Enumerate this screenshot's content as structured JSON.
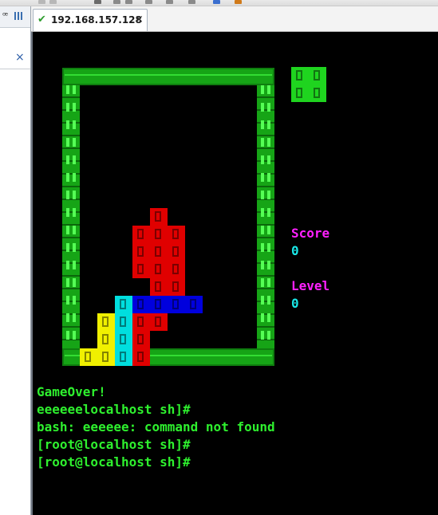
{
  "tab": {
    "title": "192.168.157.128",
    "status_icon": "check-icon",
    "close": "×"
  },
  "left_panel": {
    "pin_icon": "pin-icon",
    "close": "×"
  },
  "game": {
    "next_piece_color": "#1fd41f",
    "board_cells": [
      {
        "col": 4,
        "row": 7,
        "color": "#e00000"
      },
      {
        "col": 3,
        "row": 8,
        "color": "#e00000"
      },
      {
        "col": 4,
        "row": 8,
        "color": "#e00000"
      },
      {
        "col": 5,
        "row": 8,
        "color": "#e00000"
      },
      {
        "col": 3,
        "row": 9,
        "color": "#e00000"
      },
      {
        "col": 4,
        "row": 9,
        "color": "#e00000"
      },
      {
        "col": 5,
        "row": 9,
        "color": "#e00000"
      },
      {
        "col": 3,
        "row": 10,
        "color": "#e00000"
      },
      {
        "col": 4,
        "row": 10,
        "color": "#e00000"
      },
      {
        "col": 5,
        "row": 10,
        "color": "#e00000"
      },
      {
        "col": 4,
        "row": 11,
        "color": "#e00000"
      },
      {
        "col": 5,
        "row": 11,
        "color": "#e00000"
      },
      {
        "col": 2,
        "row": 12,
        "color": "#00dede"
      },
      {
        "col": 3,
        "row": 12,
        "color": "#0000dd"
      },
      {
        "col": 4,
        "row": 12,
        "color": "#0000dd"
      },
      {
        "col": 5,
        "row": 12,
        "color": "#0000dd"
      },
      {
        "col": 6,
        "row": 12,
        "color": "#0000dd"
      },
      {
        "col": 1,
        "row": 13,
        "color": "#f0f000"
      },
      {
        "col": 2,
        "row": 13,
        "color": "#00dede"
      },
      {
        "col": 3,
        "row": 13,
        "color": "#e00000"
      },
      {
        "col": 4,
        "row": 13,
        "color": "#e00000"
      },
      {
        "col": 1,
        "row": 14,
        "color": "#f0f000"
      },
      {
        "col": 2,
        "row": 14,
        "color": "#00dede"
      },
      {
        "col": 3,
        "row": 14,
        "color": "#e00000"
      },
      {
        "col": 0,
        "row": 15,
        "color": "#f0f000"
      },
      {
        "col": 1,
        "row": 15,
        "color": "#f0f000"
      },
      {
        "col": 2,
        "row": 15,
        "color": "#00dede"
      },
      {
        "col": 3,
        "row": 15,
        "color": "#e00000"
      }
    ],
    "score_label": "Score",
    "score_value": "0",
    "level_label": "Level",
    "level_value": "0"
  },
  "terminal_lines": [
    "GameOver!",
    "eeeeeelocalhost sh]#",
    "bash: eeeeee: command not found",
    "[root@localhost sh]#",
    "[root@localhost sh]#"
  ]
}
